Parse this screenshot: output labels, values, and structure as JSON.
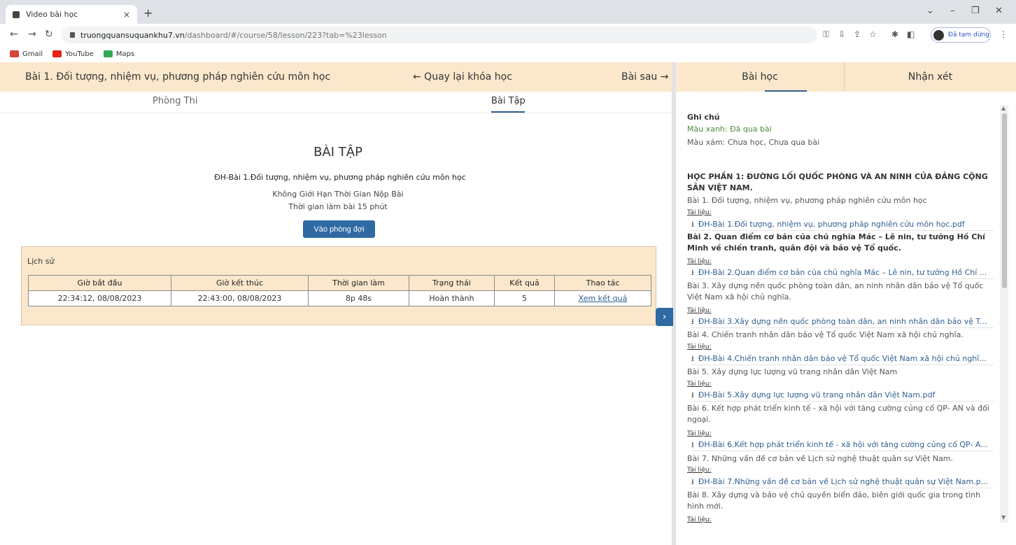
{
  "browser": {
    "tab_title": "Video bài học",
    "tab_close": "×",
    "new_tab": "+",
    "url_host": "truongquansuquankhu7.vn",
    "url_path": "/dashboard/#/course/58/lesson/223?tab=%23lesson",
    "profile_label": "Đã tạm dừng",
    "bookmarks": [
      "Gmail",
      "YouTube",
      "Maps"
    ]
  },
  "header": {
    "lesson_title": "Bài 1. Đối tượng, nhiệm vụ, phương pháp nghiên cứu môn học",
    "back": "← Quay lại khóa học",
    "next": "Bài sau →"
  },
  "subtabs": [
    "Phòng Thi",
    "Bài Tập"
  ],
  "exercise": {
    "title": "BÀI TẬP",
    "subtitle": "ĐH-Bài 1.Đối tượng, nhiệm vụ, phương pháp nghiên cứu môn học",
    "line1": "Không Giới Hạn Thời Gian Nộp Bài",
    "line2": "Thời gian làm bài 15 phút",
    "button": "Vào phòng đợi"
  },
  "history": {
    "title": "Lịch sử",
    "headers": [
      "Giờ bắt đầu",
      "Giờ kết thúc",
      "Thời gian làm",
      "Trạng thái",
      "Kết quả",
      "Thao tác"
    ],
    "row": [
      "22:34:12, 08/08/2023",
      "22:43:00, 08/08/2023",
      "8p 48s",
      "Hoàn thành",
      "5",
      "Xem kết quả"
    ]
  },
  "right_tabs": [
    "Bài học",
    "Nhận xét"
  ],
  "notes": {
    "title": "Ghi chú",
    "green": "Màu xanh: Đã qua bài",
    "gray": "Màu xám: Chưa học, Chưa qua bài"
  },
  "section": "HỌC PHẦN 1: ĐƯỜNG LỐI QUỐC PHÒNG VÀ AN NINH CỦA ĐẢNG CỘNG SẢN VIỆT NAM.",
  "lessons": [
    {
      "title": "Bài 1. Đối tượng, nhiệm vụ, phương pháp nghiên cứu môn học",
      "doc_label": "Tài liệu:",
      "doc": "ĐH-Bài 1.Đối tượng, nhiệm vụ, phương pháp nghiên cứu môn học.pdf"
    },
    {
      "title": "Bài 2. Quan điểm cơ bản của chủ nghĩa Mác – Lê nin, tư tưởng Hồ Chí Minh về chiến tranh, quân đội và bảo vệ Tổ quốc.",
      "doc_label": "Tài liệu:",
      "doc": "ĐH-Bài 2.Quan điểm cơ bản của chủ nghĩa Mác – Lê nin, tư tưởng Hồ Chí ..."
    },
    {
      "title": "Bài 3. Xây dựng nền quốc phòng toàn dân, an ninh nhân dân bảo vệ Tổ quốc Việt Nam xã hội chủ nghĩa.",
      "doc_label": "Tài liệu:",
      "doc": "ĐH-Bài 3.Xây dựng nền quốc phòng toàn dân, an ninh nhân dân bảo vệ T..."
    },
    {
      "title": "Bài 4. Chiến tranh nhân dân bảo vệ Tổ quốc Việt Nam xã hội chủ nghĩa.",
      "doc_label": "Tài liệu:",
      "doc": "ĐH-Bài 4.Chiến tranh nhân dân bảo vệ Tổ quốc Việt Nam xã hội chủ nghĩ..."
    },
    {
      "title": "Bài 5. Xây dựng lực lượng vũ trang nhân dân Việt Nam",
      "doc_label": "Tài liệu:",
      "doc": "ĐH-Bài 5.Xây dựng lực lượng vũ trang nhân dân Việt Nam.pdf"
    },
    {
      "title": "Bài 6. Kết hợp phát triển kinh tế - xã hội với tăng cường củng cố QP- AN và đối ngoại.",
      "doc_label": "Tài liệu:",
      "doc": "ĐH-Bài 6.Kết hợp phát triển kinh tế - xã hội với tăng cường củng cố QP- A..."
    },
    {
      "title": "Bài 7. Những vấn đề cơ bản về Lịch sử nghệ thuật quân sự Việt Nam.",
      "doc_label": "Tài liệu:",
      "doc": "ĐH-Bài 7.Những vấn đề cơ bản về Lịch sử nghệ thuật quân sự Việt Nam.p..."
    },
    {
      "title": "Bài 8. Xây dựng và bảo vệ chủ quyền biển đảo, biên giới quốc gia trong tình hình mới.",
      "doc_label": "Tài liệu:"
    }
  ],
  "colors": {
    "accent": "#2f6aa3",
    "header_bg": "#fbe8cc",
    "done_green": "#4d8a3a"
  }
}
